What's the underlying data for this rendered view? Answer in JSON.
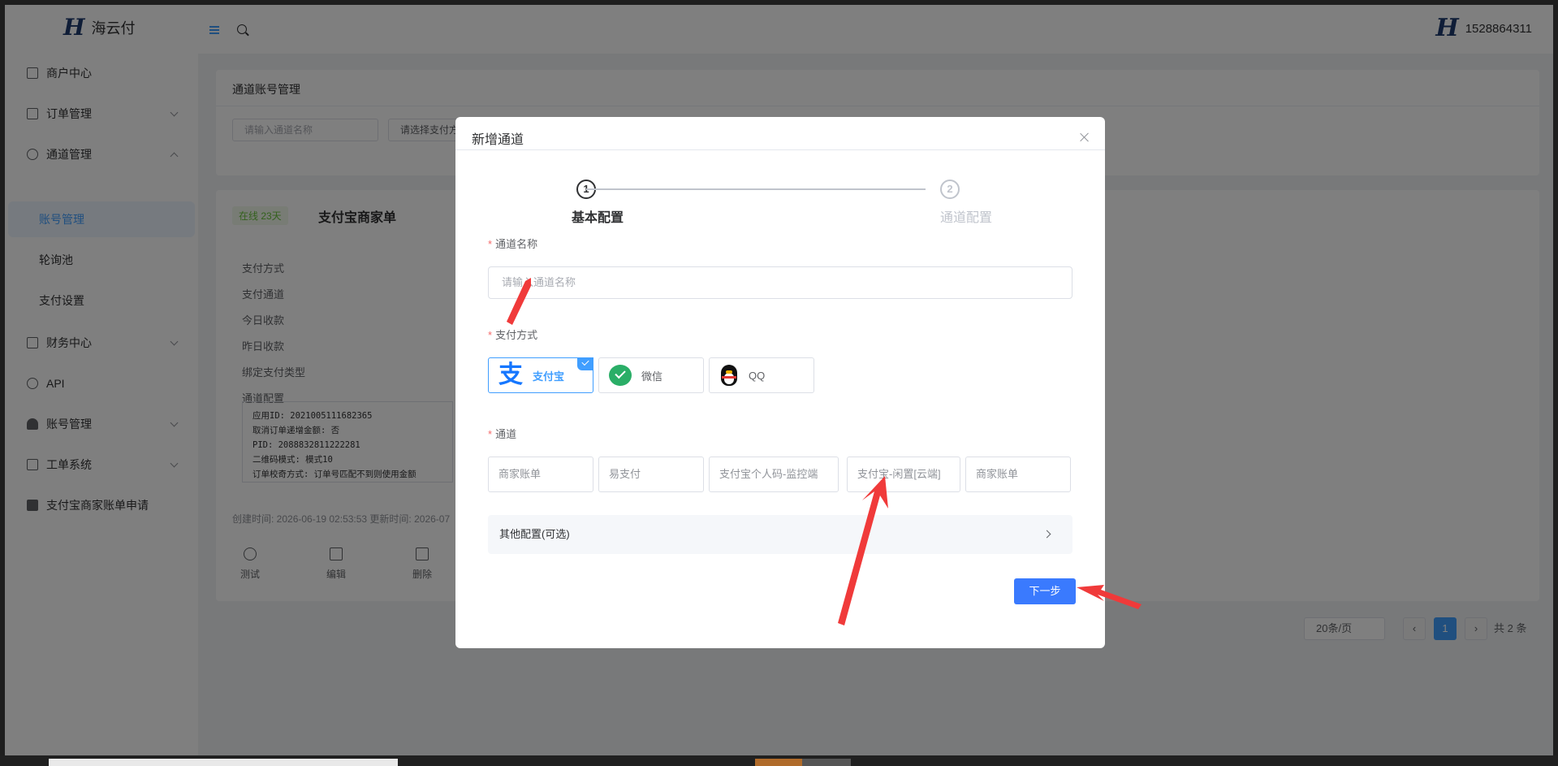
{
  "header": {
    "logo_mark": "H",
    "brand": "海云付",
    "avatar_mark": "H",
    "username": "1528864311"
  },
  "sidebar": {
    "items": [
      {
        "label": "商户中心"
      },
      {
        "label": "订单管理"
      },
      {
        "label": "通道管理"
      },
      {
        "label": "财务中心"
      },
      {
        "label": "API"
      },
      {
        "label": "账号管理"
      },
      {
        "label": "工单系统"
      },
      {
        "label": "支付宝商家账单申请"
      }
    ],
    "sub_items": [
      {
        "label": "账号管理"
      },
      {
        "label": "轮询池"
      },
      {
        "label": "支付设置"
      }
    ]
  },
  "page": {
    "title": "通道账号管理",
    "filter_name_placeholder": "请输入通道名称",
    "filter_pay_placeholder": "请选择支付方",
    "card": {
      "status": "在线 23天",
      "name": "支付宝商家单",
      "props": [
        "支付方式",
        "支付通道",
        "今日收款",
        "昨日收款",
        "绑定支付类型",
        "通道配置"
      ],
      "config_lines": [
        "应用ID: 2021005111682365",
        "取消订单递增金额: 否",
        "PID: 2088832811222281",
        "二维码模式: 模式10",
        "订单校奇方式: 订单号匹配不到则使用金额"
      ],
      "footer": "创建时间: 2026-06-19 02:53:53 更新时间: 2026-07",
      "actions": [
        "测试",
        "编辑",
        "删除"
      ]
    },
    "pager": {
      "page_size": "20条/页",
      "current": "1",
      "total": "共 2 条"
    }
  },
  "dialog": {
    "title": "新增通道",
    "steps": [
      {
        "num": "1",
        "label": "基本配置"
      },
      {
        "num": "2",
        "label": "通道配置"
      }
    ],
    "name_label": "通道名称",
    "name_placeholder": "请输入通道名称",
    "pay_label": "支付方式",
    "pay_options": [
      {
        "label": "支付宝",
        "selected": true,
        "icon": "alipay-icon"
      },
      {
        "label": "微信",
        "selected": false,
        "icon": "wechat-icon"
      },
      {
        "label": "QQ",
        "selected": false,
        "icon": "qq-icon"
      }
    ],
    "channel_label": "通道",
    "channel_options": [
      "商家账单",
      "易支付",
      "支付宝个人码-监控端",
      "支付宝-闲置[云端]",
      "商家账单"
    ],
    "other_config": "其他配置(可选)",
    "next_button": "下一步"
  },
  "colors": {
    "primary": "#409eff",
    "button": "#3a7afe",
    "required": "#f56c6c",
    "arrow": "#f03a3a"
  }
}
